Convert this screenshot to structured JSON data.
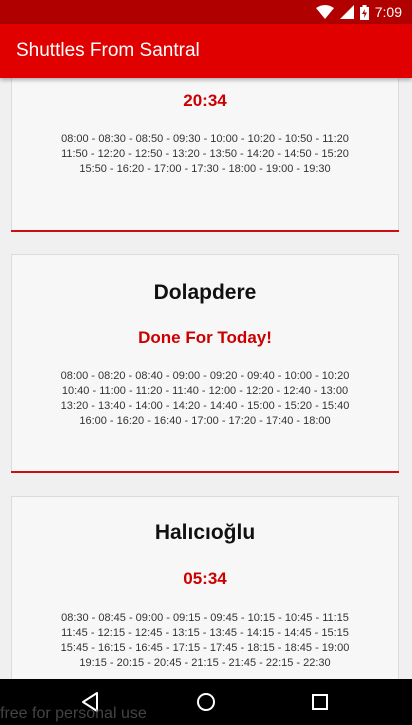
{
  "status_bar": {
    "time": "7:09"
  },
  "app_bar": {
    "title": "Shuttles From Santral"
  },
  "cards": [
    {
      "status": "20:34",
      "times": [
        "08:00 - 08:30 - 08:50 - 09:30 - 10:00 - 10:20 - 10:50 - 11:20",
        "11:50 - 12:20 - 12:50 - 13:20 - 13:50 - 14:20 - 14:50 - 15:20",
        "15:50 - 16:20 - 17:00 - 17:30 - 18:00 - 19:00 - 19:30"
      ]
    },
    {
      "name": "Dolapdere",
      "status": "Done For Today!",
      "times": [
        "08:00 - 08:20 - 08:40 - 09:00 - 09:20 - 09:40 - 10:00 - 10:20",
        "10:40 - 11:00 - 11:20 - 11:40 - 12:00 - 12:20 - 12:40 - 13:00",
        "13:20 - 13:40 - 14:00 - 14:20 - 14:40 - 15:00 - 15:20 - 15:40",
        "16:00 - 16:20 - 16:40 - 17:00 - 17:20 - 17:40 - 18:00"
      ]
    },
    {
      "name": "Halıcıoğlu",
      "status": "05:34",
      "times": [
        "08:30 - 08:45 - 09:00 - 09:15 - 09:45 - 10:15 - 10:45 - 11:15",
        "11:45 - 12:15 - 12:45 - 13:15 - 13:45 - 14:15 - 14:45 - 15:15",
        "15:45 - 16:15 - 16:45 - 17:15 - 17:45 - 18:15 - 18:45 - 19:00",
        "19:15 - 20:15 - 20:45 - 21:15 - 21:45 - 22:15 - 22:30"
      ]
    }
  ],
  "watermark": "free for personal use",
  "icons": {
    "wifi": "wifi-icon",
    "signal": "cell-signal-icon",
    "battery": "battery-charging-icon",
    "back": "back-icon",
    "home": "home-icon",
    "recents": "recents-icon"
  },
  "colors": {
    "primary": "#e00000",
    "status_bar": "#b00000",
    "accent": "#cc0000"
  }
}
